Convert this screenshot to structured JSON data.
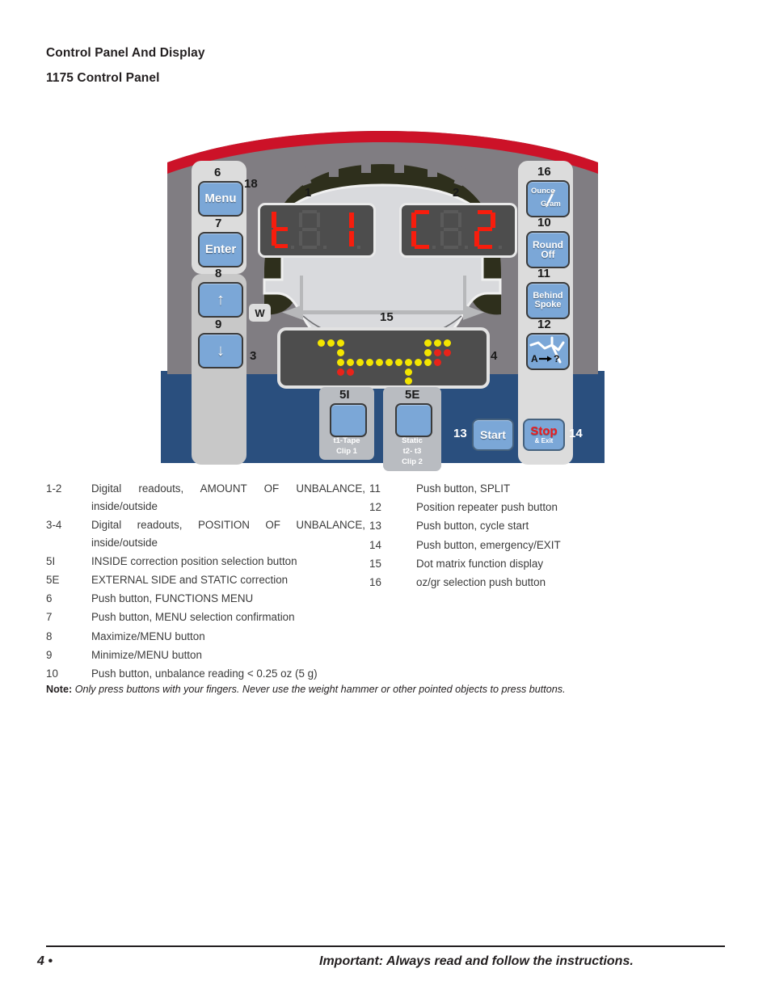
{
  "document": {
    "heading": "Control Panel And Display",
    "subheading": "1175 Control Panel"
  },
  "panel": {
    "colors": {
      "body_gray": "#807d82",
      "blue_base": "#2a4f7e",
      "red_stripe": "#cc1228",
      "key_blue": "#7ba7d7",
      "led_yellow": "#f3e500",
      "led_red": "#e8231a",
      "segment_red": "#f71d0d"
    },
    "left_keys": [
      {
        "callout": "6",
        "label": "Menu",
        "name": "menu-key"
      },
      {
        "callout": "7",
        "label": "Enter",
        "name": "enter-key"
      },
      {
        "callout": "8",
        "label": "↑",
        "name": "up-arrow-key"
      },
      {
        "callout": "9",
        "label": "↓",
        "name": "down-arrow-key"
      }
    ],
    "left_extra_callout": "18",
    "right_keys": [
      {
        "callout": "16",
        "label_top": "Ounce",
        "label_bottom": "Gram",
        "name": "ounce-gram-key"
      },
      {
        "callout": "10",
        "label_top": "Round",
        "label_bottom": "Off",
        "name": "round-off-key"
      },
      {
        "callout": "11",
        "label_top": "Behind",
        "label_bottom": "Spoke",
        "name": "behind-spoke-key"
      },
      {
        "callout": "12",
        "label_top": "A",
        "label_bottom": "?",
        "name": "position-repeater-key"
      }
    ],
    "displays": {
      "left_readout": {
        "callout": "1",
        "value": "t 1"
      },
      "right_readout": {
        "callout": "2",
        "value": "C 2"
      },
      "dot_matrix": {
        "callout_left": "3",
        "callout_right": "4",
        "callout_center": "15"
      },
      "width_badge": "W"
    },
    "bottom_keys": [
      {
        "callout": "5I",
        "lines": [
          "t1-Tape",
          "Clip 1"
        ],
        "name": "inside-correction-key"
      },
      {
        "callout": "5E",
        "lines": [
          "Static",
          "t2- t3",
          "Clip 2"
        ],
        "name": "external-static-key"
      }
    ],
    "start_key": {
      "callout": "13",
      "label": "Start",
      "name": "start-key"
    },
    "stop_key": {
      "callout": "14",
      "label": "Stop",
      "sublabel": "& Exit",
      "name": "stop-exit-key"
    }
  },
  "legend": {
    "left": [
      {
        "num": "1-2",
        "text": "Digital readouts, AMOUNT OF UNBALANCE,",
        "cont": "inside/outside",
        "justify": true
      },
      {
        "num": "3-4",
        "text": "Digital readouts, POSITION  OF UNBALANCE,",
        "cont": "inside/outside",
        "justify": true
      },
      {
        "num": "5I",
        "text": "INSIDE correction position selection button"
      },
      {
        "num": "5E",
        "text": "EXTERNAL SIDE and STATIC correction"
      },
      {
        "num": "6",
        "text": "Push button, FUNCTIONS MENU"
      },
      {
        "num": "7",
        "text": "Push button, MENU selection confirmation"
      },
      {
        "num": "8",
        "text": "Maximize/MENU button"
      },
      {
        "num": "9",
        "text": "Minimize/MENU button"
      },
      {
        "num": "10",
        "text": "Push button, unbalance reading < 0.25 oz (5 g)"
      }
    ],
    "right": [
      {
        "num": "11",
        "text": "Push button, SPLIT"
      },
      {
        "num": "12",
        "text": "Position repeater push button"
      },
      {
        "num": "13",
        "text": "Push button, cycle start"
      },
      {
        "num": "14",
        "text": "Push button, emergency/EXIT"
      },
      {
        "num": "15",
        "text": "Dot matrix function display"
      },
      {
        "num": "16",
        "text": "oz/gr selection push button"
      }
    ]
  },
  "note": {
    "label": "Note:",
    "text": "Only press buttons with your fingers. Never use the weight hammer or other pointed objects to press buttons."
  },
  "footer": {
    "page": "4 •",
    "text": "Important: Always read and follow the instructions."
  }
}
